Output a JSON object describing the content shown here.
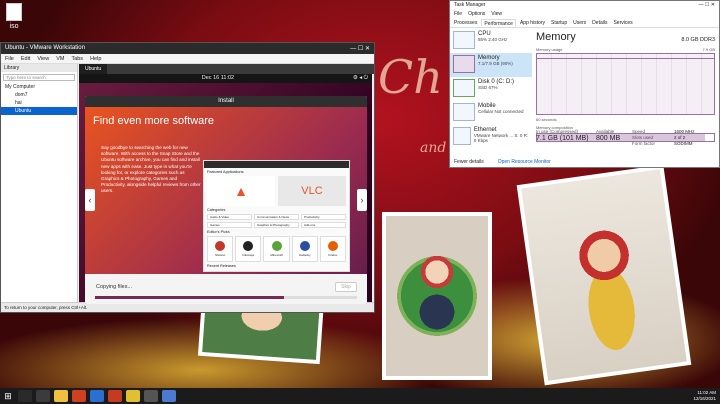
{
  "desktop": {
    "icon_label": "iso",
    "deco_text_1": "Ch",
    "deco_text_2": "and"
  },
  "vmware": {
    "title": "Ubuntu - VMware Workstation",
    "menu": [
      "File",
      "Edit",
      "View",
      "VM",
      "Tabs",
      "Help"
    ],
    "library_title": "Library",
    "search_placeholder": "Type here to search",
    "tree": {
      "root": "My Computer",
      "items": [
        "dom7",
        "hai",
        "Ubuntu"
      ]
    },
    "tab": "Ubuntu",
    "topbar_time": "Dec 16  11:02",
    "status": "To return to your computer, press Ctrl+Alt."
  },
  "installer": {
    "title": "Install",
    "heading": "Find even more software",
    "paragraph": "Say goodbye to searching the web for new software. With access to the Snap Store and the Ubuntu software archive, you can find and install new apps with ease. Just type in what you're looking for, or explore categories such as Graphics & Photography, Games and Productivity, alongside helpful reviews from other users.",
    "store": {
      "featured_label": "Featured Applications",
      "feat_vlc": "VLC",
      "categories_label": "Categories",
      "categories": [
        "Audio & Video",
        "Communication & News",
        "Productivity",
        "Games",
        "Graphics & Photography",
        "Add-ons"
      ],
      "picks_label": "Editor's Picks",
      "picks": [
        "Shotcut",
        "Inkscape",
        "Minecraft",
        "Audacity",
        "Firefox"
      ],
      "recent_label": "Recent Releases"
    },
    "copying": "Copying files...",
    "skip": "Skip",
    "progress": 0.72
  },
  "taskmgr": {
    "title": "Task Manager",
    "menu": [
      "File",
      "Options",
      "View"
    ],
    "tabs": [
      "Processes",
      "Performance",
      "App history",
      "Startup",
      "Users",
      "Details",
      "Services"
    ],
    "resources": [
      {
        "name": "CPU",
        "detail": "85% 2.40 GHz"
      },
      {
        "name": "Memory",
        "detail": "7.1/7.9 GB (90%)"
      },
      {
        "name": "Disk 0 (C: D:)",
        "detail": "SSD 67%"
      },
      {
        "name": "Mobile",
        "detail": "Cellular Not connected"
      },
      {
        "name": "Ethernet",
        "detail": "VMware Network ... S: 0 R: 0 Kbps"
      }
    ],
    "main_title": "Memory",
    "capacity": "8.0 GB DDR3",
    "usage_label": "Memory usage",
    "usage_max": "7.9 GB",
    "seconds": "60 seconds",
    "composition": "Memory composition",
    "in_use_label": "In use (Compressed)",
    "in_use_value": "7.1 GB (101 MB)",
    "available_label": "Available",
    "available_value": "800 MB",
    "speed_label": "Speed",
    "speed_value": "1600 MHz",
    "slots_label": "Slots used",
    "slots_value": "2 of 2",
    "form_label": "Form factor",
    "form_value": "SODIMM",
    "fewer": "Fewer details",
    "resmon": "Open Resource Monitor"
  },
  "taskbar": {
    "time": "11:02 AM",
    "date": "12/16/2021"
  },
  "colors": {
    "ubuntu_orange": "#e95420",
    "aubergine": "#772953",
    "mem_purple": "#9b6fa3"
  }
}
